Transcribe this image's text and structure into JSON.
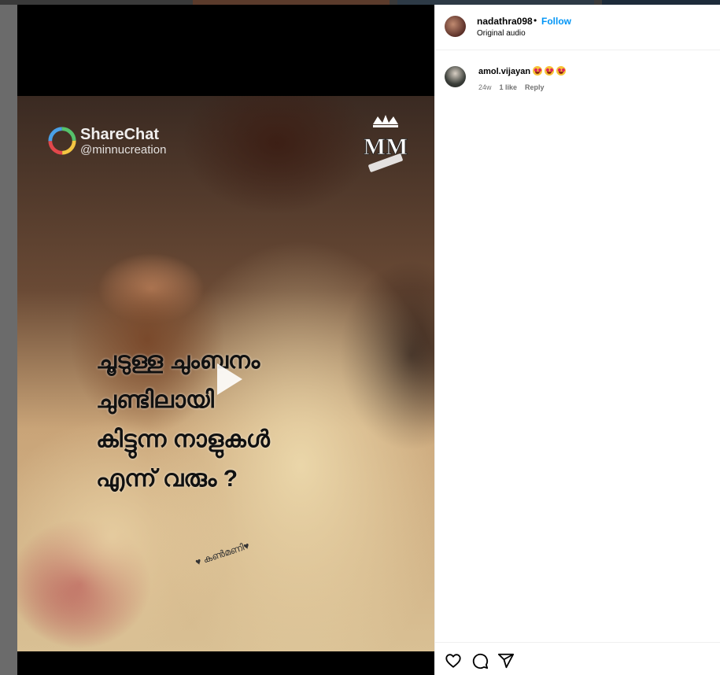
{
  "post": {
    "author": "nadathra098",
    "separator": "•",
    "follow_label": "Follow",
    "audio_label": "Original audio"
  },
  "media": {
    "watermark_brand": "ShareChat",
    "watermark_handle": "@minnucreation",
    "logo_text": "MM",
    "overlay_lines": [
      "ചൂടുള്ള ചുംബനം",
      "ചുണ്ടിലായി",
      "കിട്ടുന്ന നാളുകൾ",
      "എന്ന് വരും ?"
    ],
    "sticker_text": "♥ കൺമണി♥",
    "play_icon": "play-icon"
  },
  "comments": [
    {
      "username": "amol.vijayan",
      "emojis": [
        "smiling-face-with-heart-eyes",
        "smiling-face-with-heart-eyes",
        "smiling-face-with-heart-eyes"
      ],
      "age": "24w",
      "likes": "1 like",
      "reply_label": "Reply"
    }
  ],
  "actions": {
    "like_icon": "heart-icon",
    "comment_icon": "comment-icon",
    "share_icon": "share-icon"
  },
  "colors": {
    "follow": "#0095f6",
    "meta_text": "#737373",
    "backdrop": "#6b6b6b"
  }
}
